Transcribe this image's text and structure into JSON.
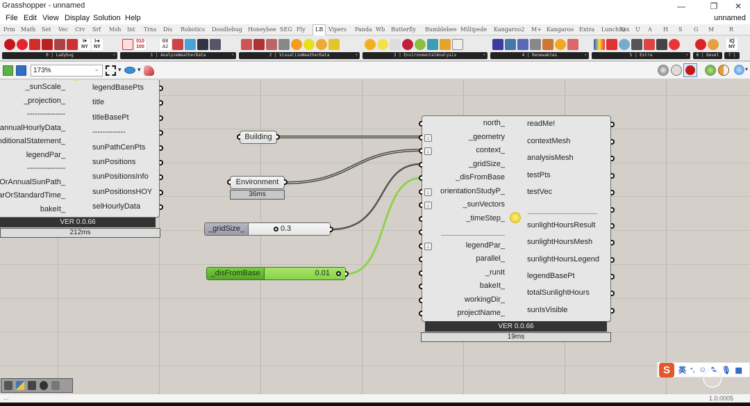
{
  "window": {
    "title": "Grasshopper - unnamed",
    "doc_name": "unnamed",
    "minimize": "—",
    "restore": "❐",
    "close": "✕"
  },
  "menu": [
    "File",
    "Edit",
    "View",
    "Display",
    "Solution",
    "Help"
  ],
  "tabs": [
    "Prm",
    "Math",
    "Set",
    "Vec",
    "Crv",
    "Srf",
    "Msh",
    "Int",
    "Trns",
    "Dis",
    "Robotics",
    "Doodlebug",
    "Honeybee",
    "SEG",
    "Fly",
    "LB",
    "Vipers",
    "Panda",
    "Wb",
    "Butterfly",
    "Bumblebee",
    "Millipede",
    "Kangaroo2",
    "M+",
    "Kangaroo",
    "Extra",
    "LunchBox",
    "Q",
    "U",
    "A",
    "H",
    "S",
    "G",
    "M",
    "R"
  ],
  "active_tab": "LB",
  "ribbon_groups": [
    {
      "label": "0 | Ladybug"
    },
    {
      "label": "1 | AnalyzeWeatherData"
    },
    {
      "label": "2 | VisualizeWeatherData"
    },
    {
      "label": "3 | EnvironmentalAnalysis"
    },
    {
      "label": "4 | Renewables"
    },
    {
      "label": "5 | Extra"
    },
    {
      "label": "6 | Devel"
    },
    {
      "label": "7 |"
    }
  ],
  "canvas_toolbar": {
    "zoom_level": "173%"
  },
  "components": {
    "sunpath": {
      "inputs": [
        "_sunScale_",
        "_projection_",
        "---------------",
        "annualHourlyData_",
        "conditionalStatement_",
        "legendPar_",
        "---------------",
        "dailyOrAnnualSunPath_",
        "solarOrStandardTime_",
        "bakeIt_"
      ],
      "outputs": [
        "legendBasePts",
        "title",
        "titleBasePt",
        "-------------",
        "sunPathCenPts",
        "sunPositions",
        "sunPositionsInfo",
        "sunPositionsHOY",
        "selHourlyData"
      ],
      "version": "VER 0.0.66",
      "time": "212ms"
    },
    "building": {
      "label": "Building"
    },
    "environment": {
      "label": "Environment",
      "time": "36ms"
    },
    "gridsize_slider": {
      "label": "_gridSize_",
      "value": "0.3"
    },
    "disfrombase_slider": {
      "label": "_disFromBase",
      "value": "0.01"
    },
    "sunlight": {
      "inputs": [
        "north_",
        "_geometry",
        "context_",
        "_gridSize_",
        "_disFromBase",
        "orientationStudyP_",
        "_sunVectors",
        "_timeStep_",
        "",
        "legendPar_",
        "parallel_",
        "_runIt",
        "bakeIt_",
        "workingDir_",
        "projectName_"
      ],
      "outputs": [
        "readMe!",
        "contextMesh",
        "analysisMesh",
        "testPts",
        "testVec",
        "sunlightHoursResult",
        "sunlightHoursMesh",
        "sunlightHoursLegend",
        "legendBasePt",
        "totalSunlightHours",
        "sunIsVisible"
      ],
      "version": "VER 0.0.66",
      "time": "19ms"
    }
  },
  "statusbar": {
    "left": "...",
    "version": "1.0.0005"
  },
  "ime": {
    "lang": "英",
    "punct": "°,",
    "logo": "S"
  },
  "colors": {
    "canvas": "#d4d0c9",
    "wire": "#555555",
    "wire_selected": "#8fd14f",
    "slider_green": "#6cc23a"
  }
}
